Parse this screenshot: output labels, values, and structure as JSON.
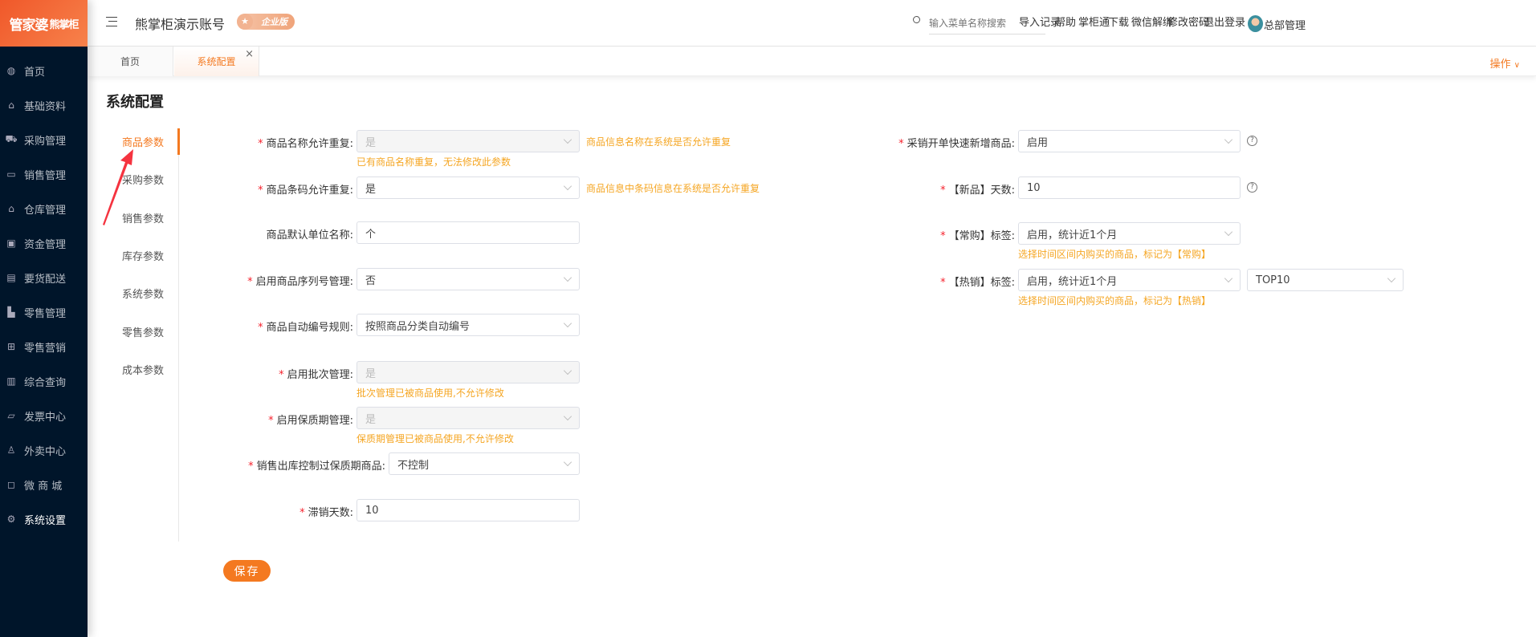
{
  "logo": "管家婆熊掌柜",
  "sidebar": {
    "items": [
      {
        "label": "首页",
        "icon": "globe-icon"
      },
      {
        "label": "基础资料",
        "icon": "home-icon"
      },
      {
        "label": "采购管理",
        "icon": "cart-icon"
      },
      {
        "label": "销售管理",
        "icon": "sales-icon"
      },
      {
        "label": "仓库管理",
        "icon": "warehouse-icon"
      },
      {
        "label": "资金管理",
        "icon": "money-icon"
      },
      {
        "label": "要货配送",
        "icon": "list-icon"
      },
      {
        "label": "零售管理",
        "icon": "area-chart-icon"
      },
      {
        "label": "零售营销",
        "icon": "gift-icon"
      },
      {
        "label": "综合查询",
        "icon": "bar-chart-icon"
      },
      {
        "label": "发票中心",
        "icon": "invoice-icon"
      },
      {
        "label": "外卖中心",
        "icon": "bell-icon"
      },
      {
        "label": "微 商 城",
        "icon": "bag-icon"
      },
      {
        "label": "系统设置",
        "icon": "gear-icon"
      }
    ],
    "active": 13
  },
  "header": {
    "title": "熊掌柜演示账号",
    "badge": "企业版",
    "search_placeholder": "输入菜单名称搜索",
    "links": [
      "导入记录",
      "帮助",
      "掌柜通",
      "下载",
      "微信解绑",
      "修改密码",
      "退出登录"
    ],
    "user": "总部管理"
  },
  "tabs": {
    "items": [
      "首页",
      "系统配置"
    ],
    "active": 1,
    "ops": "操作"
  },
  "page": {
    "title": "系统配置",
    "submenu": [
      "商品参数",
      "采购参数",
      "销售参数",
      "库存参数",
      "系统参数",
      "零售参数",
      "成本参数"
    ],
    "submenu_active": 0,
    "left_fields": [
      {
        "label": "商品名称允许重复",
        "required": true,
        "value": "是",
        "disabled": true,
        "side_hint": "商品信息名称在系统是否允许重复",
        "hint": "已有商品名称重复，无法修改此参数"
      },
      {
        "label": "商品条码允许重复",
        "required": true,
        "value": "是",
        "side_hint": "商品信息中条码信息在系统是否允许重复"
      },
      {
        "label": "商品默认单位名称",
        "required": false,
        "value": "个",
        "input": true
      },
      {
        "label": "启用商品序列号管理",
        "required": true,
        "value": "否"
      },
      {
        "label": "商品自动编号规则",
        "required": true,
        "value": "按照商品分类自动编号"
      },
      {
        "label": "启用批次管理",
        "required": true,
        "value": "是",
        "disabled": true,
        "hint": "批次管理已被商品使用,不允许修改"
      },
      {
        "label": "启用保质期管理",
        "required": true,
        "value": "是",
        "disabled": true,
        "hint": "保质期管理已被商品使用,不允许修改"
      },
      {
        "label": "销售出库控制过保质期商品",
        "required": true,
        "value": "不控制",
        "wide_label": true
      },
      {
        "label": "滞销天数",
        "required": true,
        "value": "10",
        "input": true
      }
    ],
    "right_fields": [
      {
        "label": "采销开单快速新增商品",
        "value": "启用",
        "help": true
      },
      {
        "label": "【新品】天数",
        "value": "10",
        "input": true,
        "help": true
      },
      {
        "label": "【常购】标签",
        "value": "启用，统计近1个月",
        "hint": "选择时间区间内购买的商品，标记为【常购】"
      },
      {
        "label": "【热销】标签",
        "value": "启用，统计近1个月",
        "extra": "TOP10",
        "hint": "选择时间区间内购买的商品，标记为【热销】"
      }
    ],
    "save": "保存"
  },
  "colors": {
    "accent": "#f47920",
    "sidebar": "#00152a",
    "hint": "#f5a623",
    "required": "#f5222d"
  }
}
